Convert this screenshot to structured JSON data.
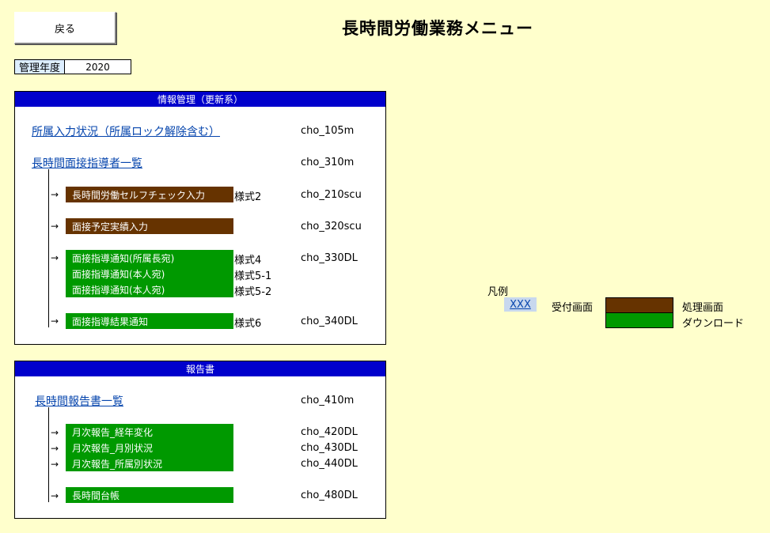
{
  "header": {
    "back_label": "戻る",
    "title": "長時間労働業務メニュー"
  },
  "year": {
    "label": "管理年度",
    "value": "2020"
  },
  "info_panel": {
    "title": "情報管理（更新系）",
    "links": [
      {
        "label": "所属入力状況（所属ロック解除含む）",
        "code": "cho_105m"
      },
      {
        "label": "長時間面接指導者一覧",
        "code": "cho_310m"
      }
    ],
    "items": [
      {
        "label": "長時間労働セルフチェック入力",
        "form": "様式2",
        "code": "cho_210scu"
      },
      {
        "label": "面接予定実績入力",
        "form": "",
        "code": "cho_320scu"
      },
      {
        "label": "面接指導通知(所属長宛)",
        "form": "様式4",
        "code": "cho_330DL"
      },
      {
        "label": "面接指導通知(本人宛)",
        "form": "様式5-1",
        "code": ""
      },
      {
        "label": "面接指導通知(本人宛)",
        "form": "様式5-2",
        "code": ""
      },
      {
        "label": "面接指導結果通知",
        "form": "様式6",
        "code": "cho_340DL"
      }
    ]
  },
  "report_panel": {
    "title": "報告書",
    "link": {
      "label": "長時間報告書一覧",
      "code": "cho_410m"
    },
    "items": [
      {
        "label": "月次報告_経年変化",
        "code": "cho_420DL"
      },
      {
        "label": "月次報告_月別状況",
        "code": "cho_430DL"
      },
      {
        "label": "月次報告_所属別状況",
        "code": "cho_440DL"
      },
      {
        "label": "長時間台帳",
        "code": "cho_480DL"
      }
    ]
  },
  "legend": {
    "title": "凡例",
    "link_sample": "XXX",
    "link_desc": "受付画面",
    "brown_desc": "処理画面",
    "green_desc": "ダウンロード"
  },
  "colors": {
    "brown": "#663300",
    "green": "#009900",
    "header_blue": "#0000cc",
    "background": "#ffffcc"
  },
  "arrow_glyph": "→"
}
